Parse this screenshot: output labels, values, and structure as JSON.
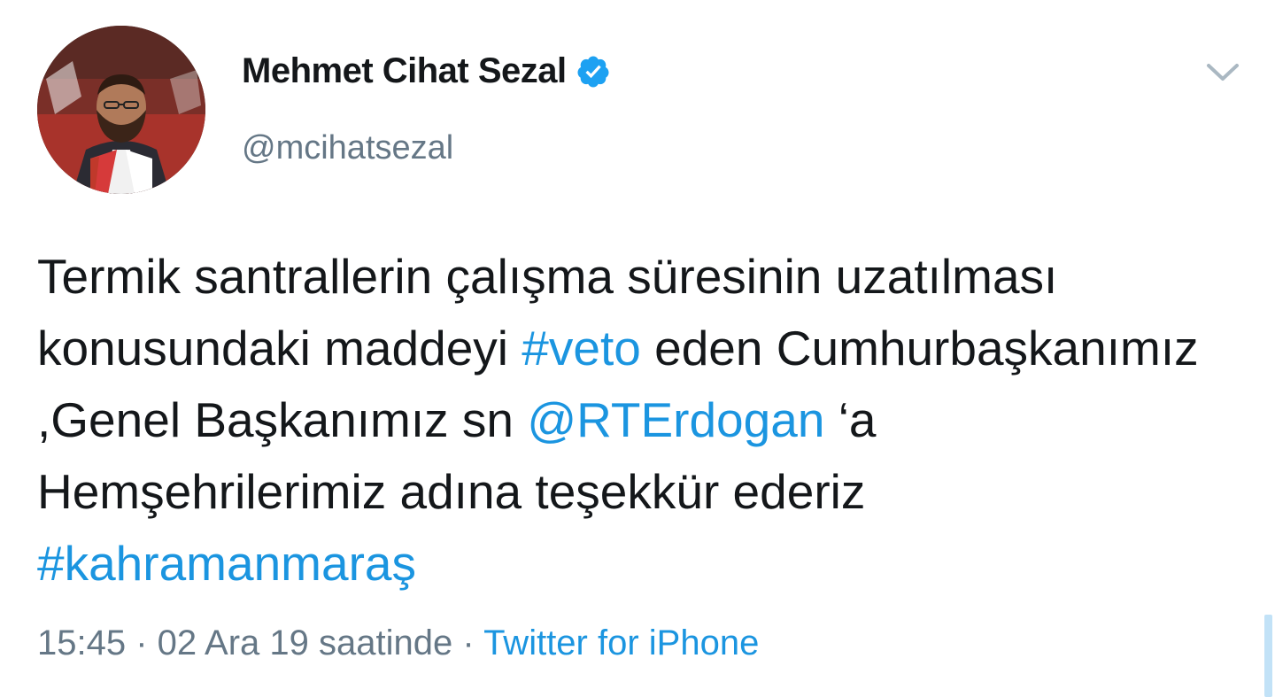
{
  "author": {
    "display_name": "Mehmet Cihat Sezal",
    "handle": "@mcihatsezal",
    "verified": true,
    "avatar_icon": "profile-photo"
  },
  "tweet": {
    "segments": [
      {
        "text": "Termik santrallerin çalışma süresinin uzatılması konusundaki maddeyi ",
        "link": false
      },
      {
        "text": "#veto",
        "link": true
      },
      {
        "text": " eden Cumhurbaşkanımız ,Genel Başkanımız sn ",
        "link": false
      },
      {
        "text": "@RTErdogan",
        "link": true
      },
      {
        "text": " ‘a Hemşehrilerimiz adına teşekkür ederiz ",
        "link": false
      },
      {
        "text": "#kahramanmaraş",
        "link": true
      }
    ]
  },
  "meta": {
    "time": "15:45",
    "separator": " · ",
    "date": "02 Ara 19 saatinde",
    "source": "Twitter for iPhone"
  },
  "icons": {
    "verified": "verified-badge-icon",
    "menu": "chevron-down-icon"
  },
  "colors": {
    "link": "#1b95e0",
    "text": "#14171a",
    "secondary": "#657786",
    "verified": "#1da1f2"
  }
}
